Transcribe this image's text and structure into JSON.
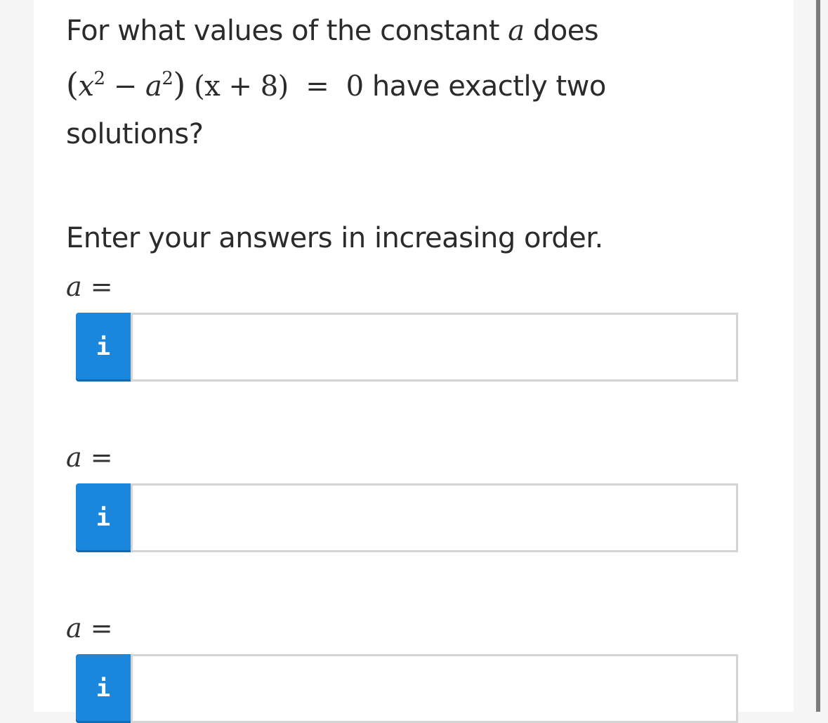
{
  "question": {
    "line1_prefix": "For what values of the constant",
    "line1_var": "a",
    "line1_suffix": "does",
    "eq_open_paren": "(",
    "eq_x": "x",
    "eq_exp1": "2",
    "eq_minus": "−",
    "eq_a": "a",
    "eq_exp2": "2",
    "eq_close_paren": ")",
    "eq_factor": "(x + 8)",
    "eq_equals": "=",
    "eq_zero": "0",
    "line2_suffix": "have exactly two",
    "line3": "solutions?"
  },
  "instruction": "Enter your answers in increasing order.",
  "answers": [
    {
      "label_var": "a",
      "label_eq": "=",
      "info_icon": "i",
      "value": ""
    },
    {
      "label_var": "a",
      "label_eq": "=",
      "info_icon": "i",
      "value": ""
    },
    {
      "label_var": "a",
      "label_eq": "=",
      "info_icon": "i",
      "value": ""
    }
  ],
  "colors": {
    "info_button": "#1a86dc",
    "text": "#2b2b2b",
    "input_border": "#d4d4d4"
  }
}
